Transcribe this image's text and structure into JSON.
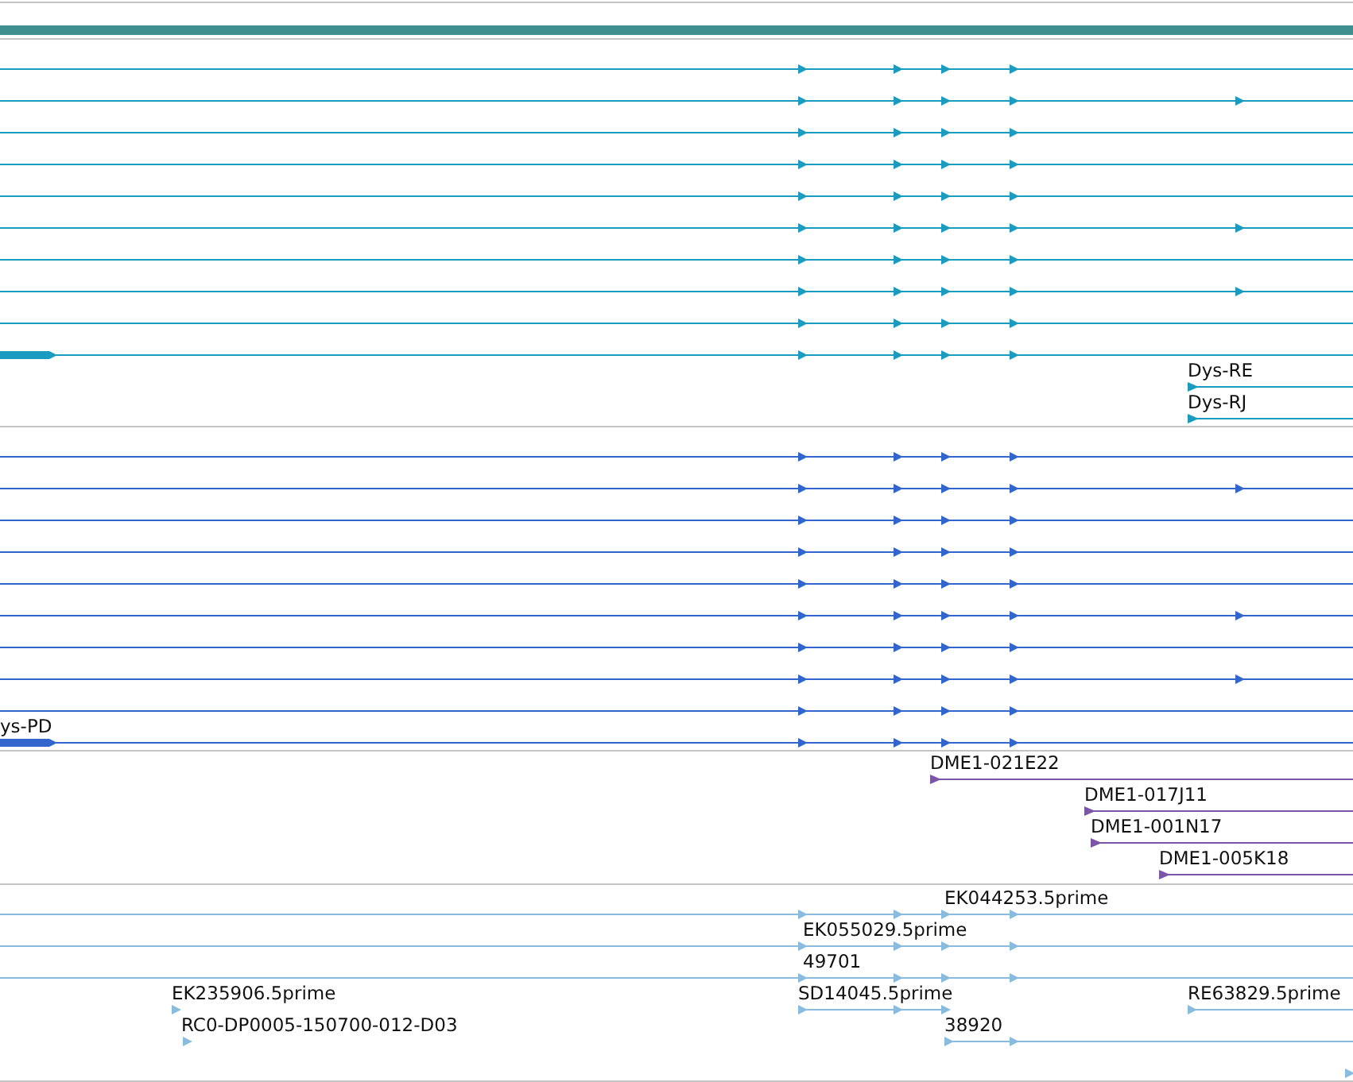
{
  "tracks": [
    {
      "color": "#1a9bbf",
      "labels": [
        "Dys-RE",
        "Dys-RJ"
      ]
    },
    {
      "color": "#3366cc",
      "labels": [
        "ys-PD"
      ]
    },
    {
      "color": "#7b55a8",
      "labels": [
        "DME1-021E22",
        "DME1-017J11",
        "DME1-001N17",
        "DME1-005K18"
      ]
    },
    {
      "color": "#88bbdd",
      "labels": [
        "EK044253.5prime",
        "EK055029.5prime",
        "49701",
        "EK235906.5prime",
        "SD14045.5prime",
        "RE63829.5prime",
        "RC0-DP0005-150700-012-D03",
        "38920"
      ]
    }
  ]
}
